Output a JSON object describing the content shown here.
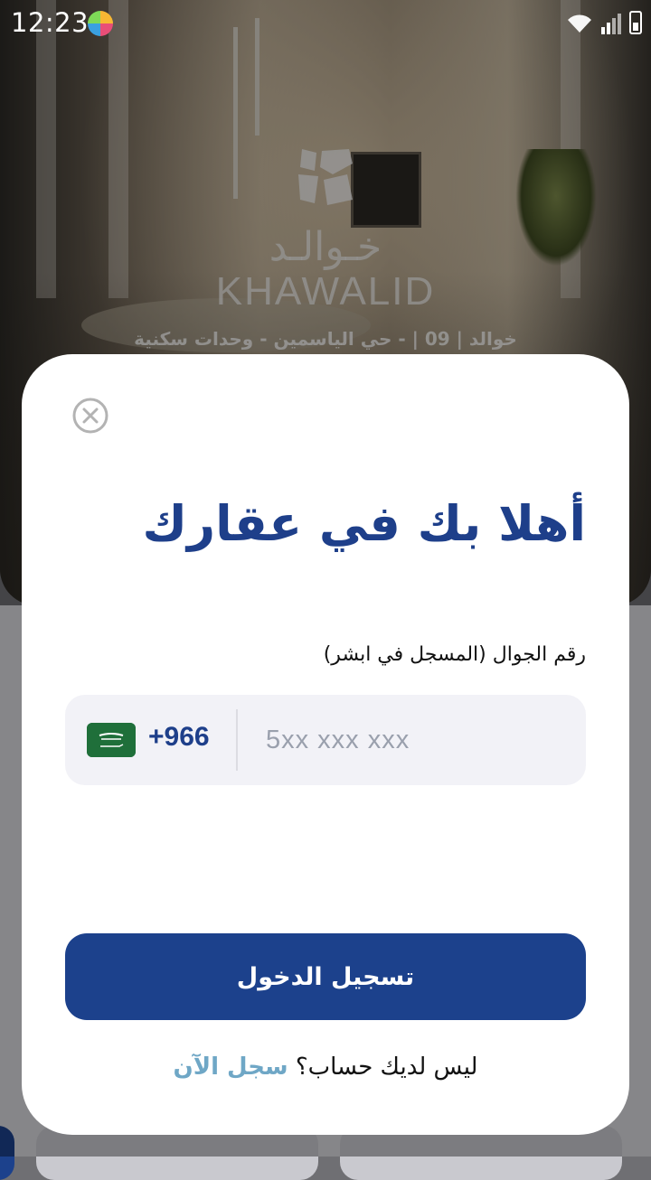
{
  "status_bar": {
    "time": "12:23",
    "icons": [
      "app-notification-icon",
      "wifi-icon",
      "signal-icon",
      "battery-icon"
    ]
  },
  "background": {
    "brand_arabic": "خـوالـد",
    "brand_latin": "KHAWALID",
    "project_line": "خوالد | 09 | - حي الياسمين - وحدات سكنية"
  },
  "modal": {
    "close_icon": "close-circle-icon",
    "welcome_title": "أهلا بك في عقارك",
    "phone_label": "رقم الجوال (المسجل في ابشر)",
    "phone_placeholder": "5xx xxx xxx",
    "phone_value": "",
    "dial_code": "+966",
    "country_flag": "saudi-arabia-flag",
    "login_button": "تسجيل الدخول",
    "signup_prompt": "ليس لديك حساب؟",
    "signup_link": "سجل الآن"
  },
  "colors": {
    "primary": "#1c418c",
    "title": "#1e3f8a",
    "link": "#6fa7c6",
    "field_bg": "#f2f2f7"
  }
}
